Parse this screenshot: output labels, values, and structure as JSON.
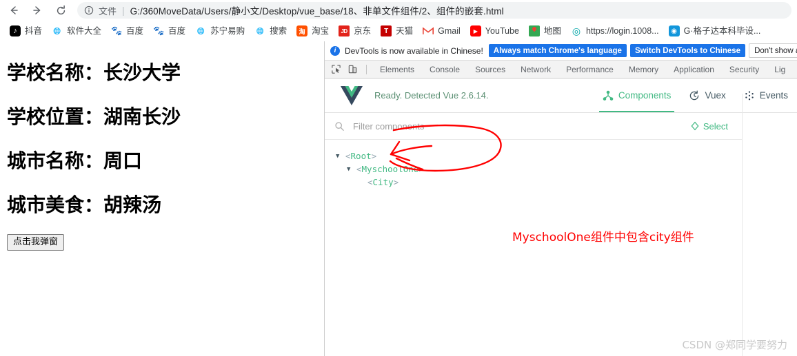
{
  "browser": {
    "nav": {
      "back_icon": "arrow-left-icon",
      "forward_icon": "arrow-right-icon",
      "reload_icon": "reload-icon"
    },
    "omnibox": {
      "info_icon": "info-icon",
      "scheme_label": "文件",
      "divider": "|",
      "url": "G:/360MoveData/Users/静小文/Desktop/vue_base/18、非单文件组件/2、组件的嵌套.html"
    },
    "bookmarks": [
      {
        "label": "抖音",
        "icon": "douyin-favicon",
        "kind": "douyin"
      },
      {
        "label": "软件大全",
        "icon": "globe-favicon",
        "kind": "globe"
      },
      {
        "label": "百度",
        "icon": "baidu-favicon",
        "kind": "baidu"
      },
      {
        "label": "百度",
        "icon": "baidu-favicon",
        "kind": "baidu"
      },
      {
        "label": "苏宁易购",
        "icon": "globe-favicon",
        "kind": "globe"
      },
      {
        "label": "搜索",
        "icon": "globe-favicon",
        "kind": "globe"
      },
      {
        "label": "淘宝",
        "icon": "taobao-favicon",
        "kind": "taobao"
      },
      {
        "label": "京东",
        "icon": "jd-favicon",
        "kind": "jd"
      },
      {
        "label": "天猫",
        "icon": "tmall-favicon",
        "kind": "tmall"
      },
      {
        "label": "Gmail",
        "icon": "gmail-favicon",
        "kind": "gmail"
      },
      {
        "label": "YouTube",
        "icon": "youtube-favicon",
        "kind": "youtube"
      },
      {
        "label": "地图",
        "icon": "google-maps-favicon",
        "kind": "map"
      },
      {
        "label": "https://login.1008...",
        "icon": "seal-favicon",
        "kind": "seal"
      },
      {
        "label": "G·格子达本科毕设...",
        "icon": "gezida-favicon",
        "kind": "gz"
      }
    ]
  },
  "page": {
    "lines": [
      "学校名称：长沙大学",
      "学校位置：湖南长沙",
      "城市名称：周口",
      "城市美食：胡辣汤"
    ],
    "button_label": "点击我弹窗"
  },
  "devtools": {
    "banner": {
      "info_icon": "info-circle-icon",
      "message": "DevTools is now available in Chinese!",
      "buttons": [
        {
          "label": "Always match Chrome's language",
          "style": "primary"
        },
        {
          "label": "Switch DevTools to Chinese",
          "style": "primary"
        },
        {
          "label": "Don't show again",
          "style": "ghost"
        }
      ]
    },
    "toolbar_icons": [
      {
        "name": "inspect-element-icon"
      },
      {
        "name": "device-toolbar-icon"
      }
    ],
    "tabs": [
      "Elements",
      "Console",
      "Sources",
      "Network",
      "Performance",
      "Memory",
      "Application",
      "Security",
      "Lig"
    ],
    "active_tab": "",
    "vue": {
      "logo_icon": "vue-logo-icon",
      "status": "Ready. Detected Vue 2.6.14.",
      "tabs": [
        {
          "label": "Components",
          "icon": "component-tree-icon",
          "active": true
        },
        {
          "label": "Vuex",
          "icon": "history-clock-icon",
          "active": false
        },
        {
          "label": "Events",
          "icon": "events-dots-icon",
          "active": false
        }
      ],
      "filter": {
        "search_icon": "search-icon",
        "placeholder": "Filter components",
        "value": "",
        "select_icon": "target-select-icon",
        "select_label": "Select"
      },
      "tree": [
        {
          "depth": 1,
          "caret": "▼",
          "open": "<",
          "name": "Root",
          "close": ">"
        },
        {
          "depth": 2,
          "caret": "▼",
          "open": "<",
          "name": "MyschoolOne",
          "close": ">"
        },
        {
          "depth": 3,
          "caret": "",
          "open": "<",
          "name": "City",
          "close": ">"
        }
      ]
    },
    "annotation": {
      "text": "MyschoolOne组件中包含city组件",
      "color": "#ff0000",
      "shape": "lasso-with-arrow"
    },
    "watermark": "CSDN @郑同学要努力"
  },
  "colors": {
    "chrome_bg": "#ffffff",
    "omnibox_bg": "#f1f3f4",
    "devtools_tabbar_bg": "#f3f3f3",
    "accent_blue": "#1a73e8",
    "vue_green": "#42b983",
    "annotation_red": "#ff0000"
  }
}
